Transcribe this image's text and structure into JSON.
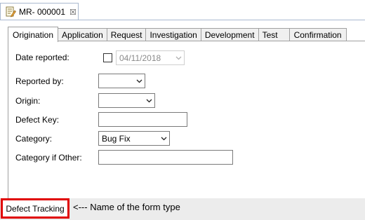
{
  "editor_tab": {
    "title": "MR- 000001",
    "icon": "document-edit-icon",
    "close_symbol": "☒"
  },
  "subtabs": [
    {
      "label": "Origination",
      "active": true
    },
    {
      "label": "Application",
      "active": false
    },
    {
      "label": "Request",
      "active": false
    },
    {
      "label": "Investigation",
      "active": false
    },
    {
      "label": "Development",
      "active": false
    },
    {
      "label": "Test",
      "active": false
    },
    {
      "label": "Confirmation",
      "active": false
    }
  ],
  "form": {
    "date_reported": {
      "label": "Date reported:",
      "checked": false,
      "value": "04/11/2018",
      "enabled": false
    },
    "reported_by": {
      "label": "Reported by:",
      "value": ""
    },
    "origin": {
      "label": "Origin:",
      "value": ""
    },
    "defect_key": {
      "label": "Defect Key:",
      "value": ""
    },
    "category": {
      "label": "Category:",
      "value": "Bug Fix"
    },
    "category_other": {
      "label": "Category if Other:",
      "value": ""
    }
  },
  "footer": {
    "form_type": "Defect Tracking",
    "annotation": "<--- Name of the form type",
    "highlight_color": "#e00000"
  }
}
